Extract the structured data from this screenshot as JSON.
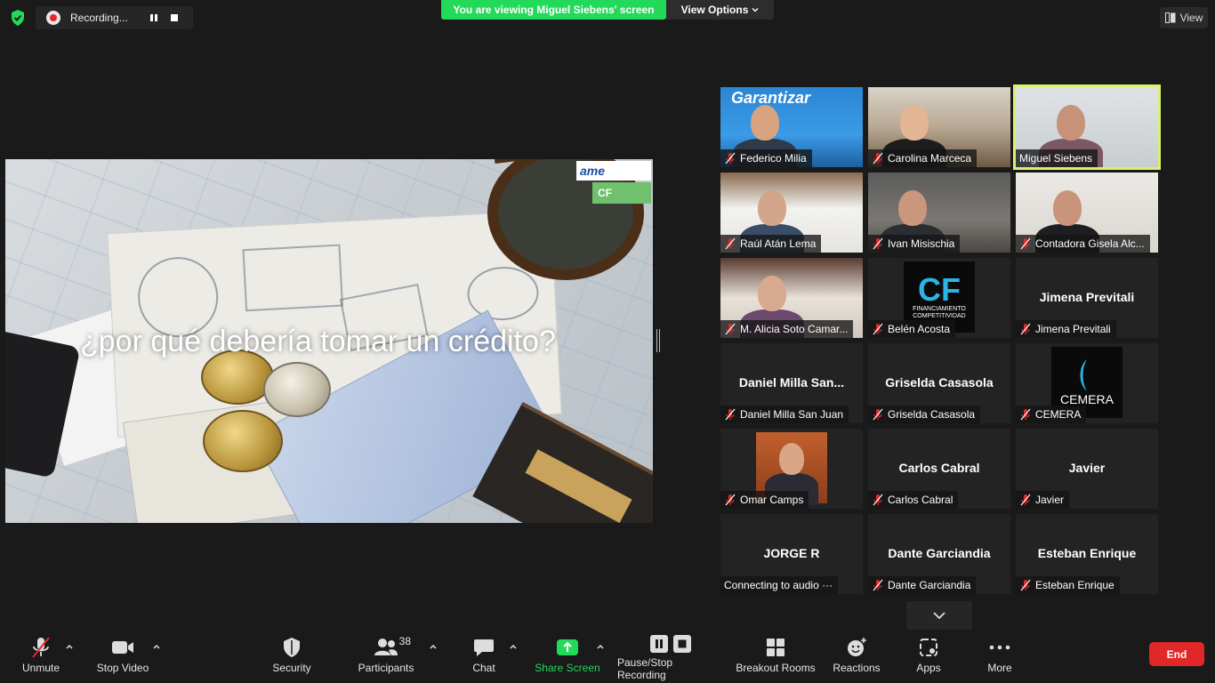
{
  "top": {
    "recording_label": "Recording...",
    "banner_text": "You are viewing Miguel Siebens' screen",
    "view_options_label": "View Options",
    "view_label": "View"
  },
  "shared_screen": {
    "slide_title": "¿por qué debería tomar un crédito?",
    "logo_primary": "ame",
    "logo_secondary": "CF"
  },
  "participants": [
    {
      "name": "Federico Milia",
      "display": "video",
      "muted": true
    },
    {
      "name": "Carolina Marceca",
      "display": "video",
      "muted": true
    },
    {
      "name": "Miguel Siebens",
      "display": "video",
      "muted": false,
      "active_speaker": true
    },
    {
      "name": "Raúl Atán Lema",
      "display": "video",
      "muted": true
    },
    {
      "name": "Ivan Misischia",
      "display": "video",
      "muted": true
    },
    {
      "name": "Contadora Gisela Alc...",
      "display": "video",
      "muted": true
    },
    {
      "name": "M. Alicia Soto Camar...",
      "display": "video",
      "muted": true
    },
    {
      "name": "Belén Acosta",
      "display": "logo",
      "logo_text": "FINANCIAMIENTO COMPETITIVIDAD",
      "muted": true
    },
    {
      "name": "Jimena Previtali",
      "display": "name",
      "big_name": "Jimena Previtali",
      "muted": true
    },
    {
      "name": "Daniel Milla San Juan",
      "display": "name",
      "big_name": "Daniel  Milla  San...",
      "muted": true
    },
    {
      "name": "Griselda Casasola",
      "display": "name",
      "big_name": "Griselda Casasola",
      "muted": true
    },
    {
      "name": "CEMERA",
      "display": "logo",
      "logo_text": "CEMERA",
      "muted": true
    },
    {
      "name": "Omar Camps",
      "display": "photo",
      "muted": true
    },
    {
      "name": "Carlos Cabral",
      "display": "name",
      "big_name": "Carlos Cabral",
      "muted": true
    },
    {
      "name": "Javier",
      "display": "name",
      "big_name": "Javier",
      "muted": true
    },
    {
      "name": "Connecting to audio ···",
      "display": "name",
      "big_name": "JORGE R",
      "muted": false
    },
    {
      "name": "Dante Garciandia",
      "display": "name",
      "big_name": "Dante Garciandia",
      "muted": true
    },
    {
      "name": "Esteban Enrique",
      "display": "name",
      "big_name": "Esteban Enrique",
      "muted": true
    }
  ],
  "toolbar": {
    "unmute": "Unmute",
    "stop_video": "Stop Video",
    "security": "Security",
    "participants": "Participants",
    "participants_count": "38",
    "chat": "Chat",
    "share_screen": "Share Screen",
    "pause_stop_recording": "Pause/Stop Recording",
    "breakout_rooms": "Breakout Rooms",
    "reactions": "Reactions",
    "apps": "Apps",
    "more": "More",
    "end": "End"
  },
  "colors": {
    "banner_green": "#23d959",
    "end_red": "#e02828",
    "active_speaker": "#d9f26b",
    "muted_red": "#e02828"
  }
}
